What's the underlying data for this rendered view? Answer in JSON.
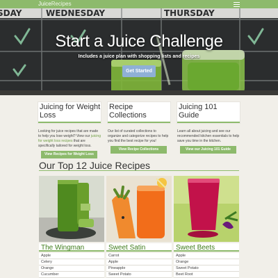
{
  "navbar": {
    "brand_part1": "Juice",
    "brand_part2": "Recipes",
    "menu_icon": "hamburger-icon"
  },
  "hero": {
    "title": "Start a Juice Challenge",
    "subtitle": "Includes a juice plan with shopping lists and recipes",
    "button_label": "Get Started",
    "chalkboard_words": [
      "SDAY",
      "WEDNESDAY",
      "THURSDAY"
    ]
  },
  "features": [
    {
      "title": "Juicing for Weight Loss",
      "text_before": "Looking for juice recipes that are made to help you lose weight? View our ",
      "link": "juicing for weight loss recipes",
      "text_after": " that are specifically tailored for weight loss.",
      "button": "View Recipes for Weight Loss"
    },
    {
      "title": "Recipe Collections",
      "text_before": "Our list of curated collections to organize and categorize recipes to help you find the best recipe for you!",
      "link": "",
      "text_after": "",
      "button": "View Recipe Collections"
    },
    {
      "title": "Juicing 101 Guide",
      "text_before": "Learn all about juicing and see our recommended kitchen essentials to help save you time in the kitchen.",
      "link": "",
      "text_after": "",
      "button": "View our Juicing 101 Guide"
    }
  ],
  "top_recipes": {
    "title": "Our Top 12 Juice Recipes",
    "cards": [
      {
        "name": "The Wingman",
        "ingredients": [
          "Apple",
          "Celery",
          "Orange",
          "Cucumber"
        ]
      },
      {
        "name": "Sweet Satin",
        "ingredients": [
          "Carrot",
          "Apple",
          "Pineapple",
          "Sweet Potato"
        ]
      },
      {
        "name": "Sweet Beets",
        "ingredients": [
          "Apple",
          "Orange",
          "Sweet Potato",
          "Beet Root"
        ]
      }
    ]
  },
  "colors": {
    "accent_green": "#8dba6c",
    "button_blue": "#8fb0d6",
    "link_green": "#6e9d44",
    "page_bg": "#f1efe9"
  }
}
